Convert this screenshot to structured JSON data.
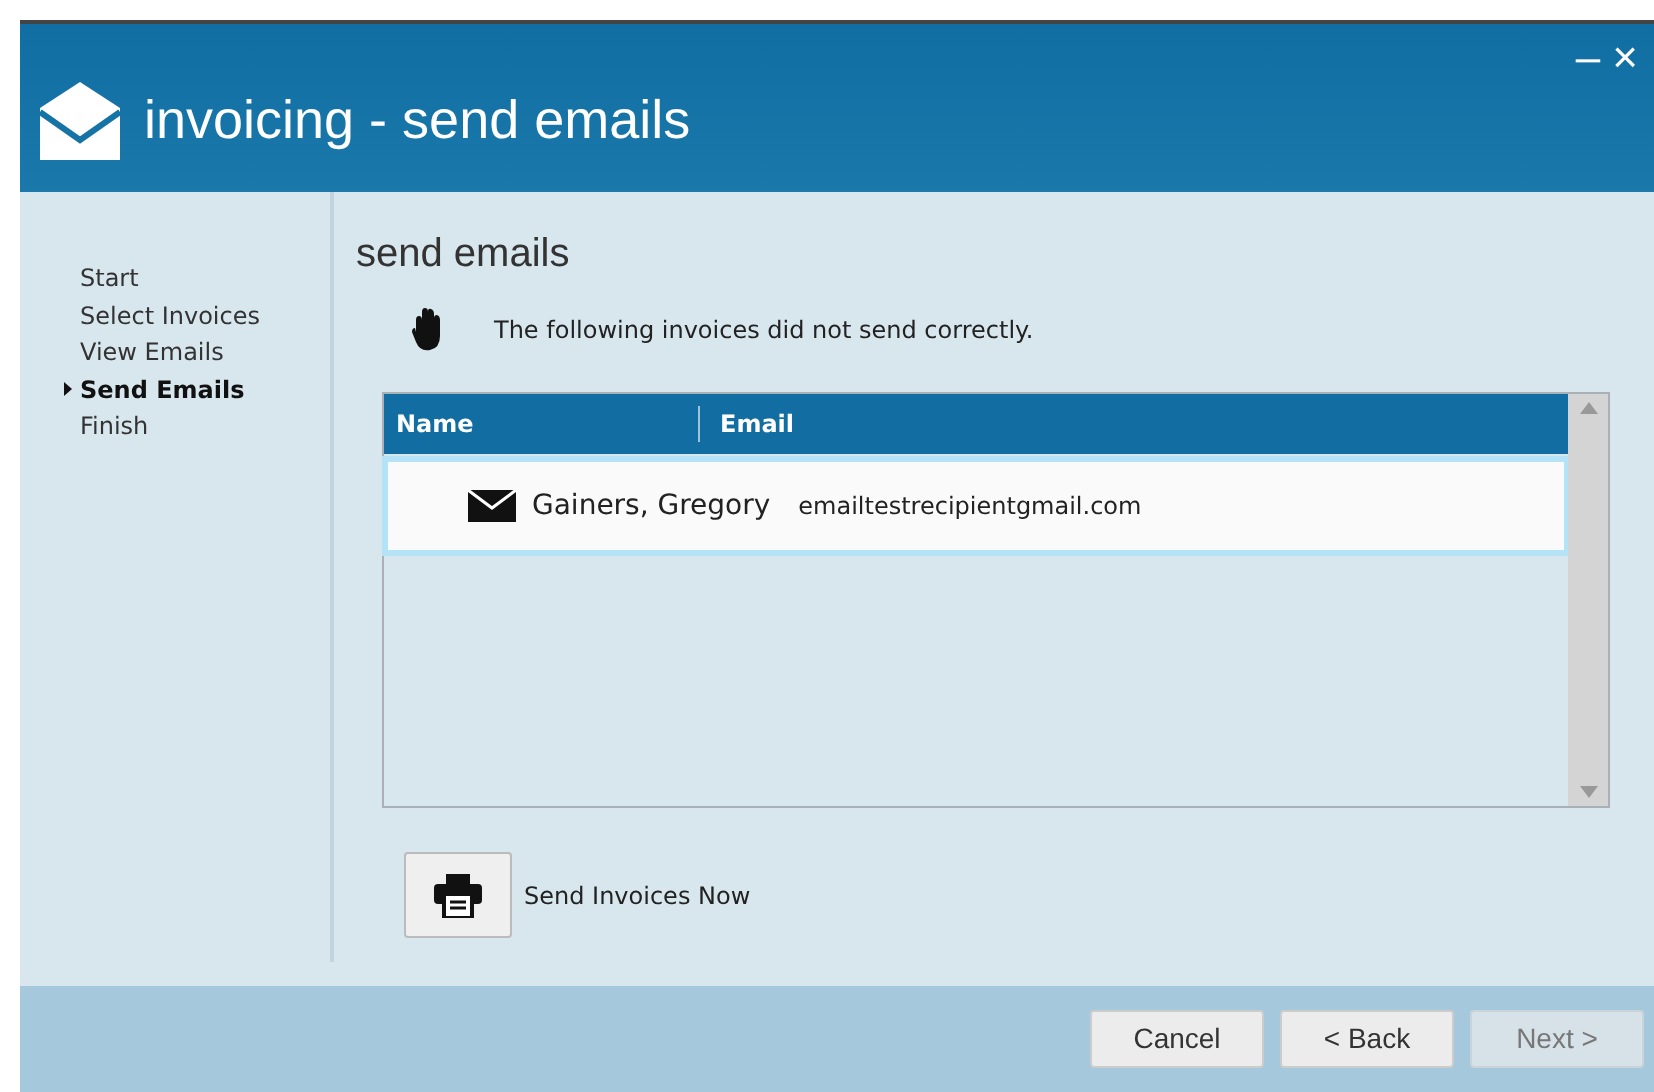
{
  "window": {
    "title": "invoicing - send emails",
    "controls": [
      "–",
      "×"
    ]
  },
  "steps": [
    {
      "label": "Start",
      "selected": false
    },
    {
      "label": "Select Invoices",
      "selected": false
    },
    {
      "label": "View Emails",
      "selected": false
    },
    {
      "label": "Send Emails",
      "selected": true
    },
    {
      "label": "Finish",
      "selected": false
    }
  ],
  "page": {
    "heading": "send emails",
    "message": "The following invoices did not send correctly."
  },
  "table": {
    "columns": [
      "Name",
      "Email"
    ],
    "rows": [
      {
        "name": "Gainers, Gregory",
        "email": "emailtestrecipientgmail.com",
        "selected": true
      }
    ]
  },
  "action": {
    "label": "Send Invoices Now"
  },
  "buttons": [
    {
      "label": "Cancel",
      "disabled": false
    },
    {
      "label": "< Back",
      "disabled": false
    },
    {
      "label": "Next >",
      "disabled": true
    }
  ]
}
